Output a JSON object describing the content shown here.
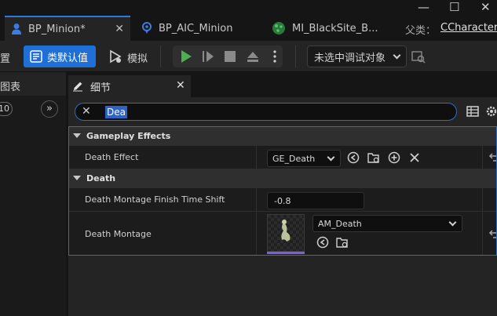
{
  "tabs": [
    {
      "label": "BP_Minion*",
      "active": true,
      "icon": "pawn-icon"
    },
    {
      "label": "BP_AIC_Minion",
      "active": false,
      "icon": "ai-controller-icon"
    },
    {
      "label": "MI_BlackSite_B...",
      "active": false,
      "icon": "material-instance-icon"
    }
  ],
  "parent": {
    "label": "父类：",
    "value": "CCharacter"
  },
  "toolbar": {
    "settings_partial": "置",
    "class_defaults": "类默认值",
    "simulate": "模拟",
    "debug_select": "未选中调试对象"
  },
  "left_panel": {
    "title": "图表",
    "count": "10"
  },
  "details": {
    "title": "细节",
    "search_value": "Dea",
    "categories": [
      {
        "name": "Gameplay Effects",
        "properties": [
          {
            "name": "Death Effect",
            "value": "GE_Death"
          }
        ]
      },
      {
        "name": "Death",
        "properties": [
          {
            "name": "Death Montage Finish Time Shift",
            "value": "-0.8"
          },
          {
            "name": "Death Montage",
            "value": "AM_Death"
          }
        ]
      }
    ]
  },
  "colors": {
    "accent": "#1f6fd6",
    "selection": "#2a6fc9",
    "play": "#4caf50"
  }
}
